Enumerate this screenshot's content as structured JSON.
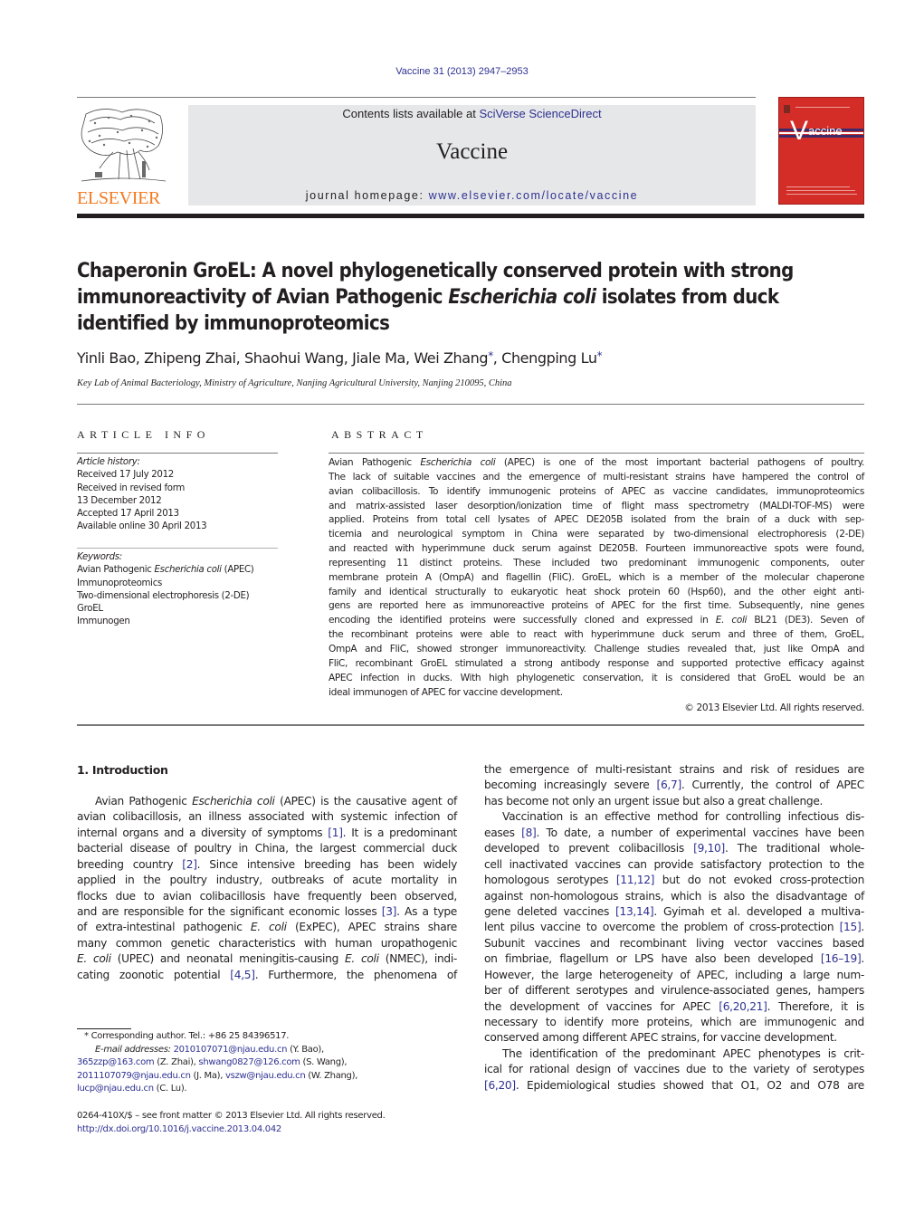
{
  "header": {
    "citation": "Vaccine 31 (2013) 2947–2953",
    "contents_prefix": "Contents lists available at ",
    "contents_link": "SciVerse ScienceDirect",
    "journal_name": "Vaccine",
    "homepage_prefix": "journal homepage: ",
    "homepage_link": "www.elsevier.com/locate/vaccine",
    "publisher_wordmark": "ELSEVIER",
    "cover_title": "accine",
    "cover_initial": "V",
    "colors": {
      "link": "#2e3192",
      "elsevier_orange": "#f47920",
      "cover_red": "#d42d27",
      "masthead_gray": "#e6e7e8"
    }
  },
  "article": {
    "title_lines": [
      "Chaperonin GroEL: A novel phylogenetically conserved protein with strong",
      [
        "immunoreactivity of Avian Pathogenic ",
        "Escherichia coli",
        " isolates from duck"
      ],
      "identified by immunoproteomics"
    ],
    "authors": [
      {
        "name": "Yinli Bao",
        "corresponding": false
      },
      {
        "name": "Zhipeng Zhai",
        "corresponding": false
      },
      {
        "name": "Shaohui Wang",
        "corresponding": false
      },
      {
        "name": "Jiale Ma",
        "corresponding": false
      },
      {
        "name": "Wei Zhang",
        "corresponding": true
      },
      {
        "name": "Chengping Lu",
        "corresponding": true
      }
    ],
    "affiliation": "Key Lab of Animal Bacteriology, Ministry of Agriculture, Nanjing Agricultural University, Nanjing 210095, China"
  },
  "article_info": {
    "heading": "ARTICLE INFO",
    "history_label": "Article history:",
    "history": [
      "Received 17 July 2012",
      "Received in revised form",
      "13 December 2012",
      "Accepted 17 April 2013",
      "Available online 30 April 2013"
    ],
    "keywords_label": "Keywords:",
    "keywords": [
      [
        "Avian Pathogenic ",
        "Escherichia coli",
        " (APEC)"
      ],
      "Immunoproteomics",
      "Two-dimensional electrophoresis (2-DE)",
      "GroEL",
      "Immunogen"
    ]
  },
  "abstract": {
    "heading": "ABSTRACT",
    "lines": [
      [
        "Avian Pathogenic ",
        "Escherichia coli",
        " (APEC) is one of the most important bacterial pathogens of poultry."
      ],
      "The lack of suitable vaccines and the emergence of multi-resistant strains have hampered the control of",
      "avian colibacillosis. To identify immunogenic proteins of APEC as vaccine candidates, immunoproteomics",
      "and matrix-assisted laser desorption/ionization time of flight mass spectrometry (MALDI-TOF-MS) were",
      "applied. Proteins from total cell lysates of APEC DE205B isolated from the brain of a duck with sep-",
      "ticemia and neurological symptom in China were separated by two-dimensional electrophoresis (2-DE)",
      "and reacted with hyperimmune duck serum against DE205B. Fourteen immunoreactive spots were found,",
      "representing 11 distinct proteins. These included two predominant immunogenic components, outer",
      "membrane protein A (OmpA) and flagellin (FliC). GroEL, which is a member of the molecular chaperone",
      "family and identical structurally to eukaryotic heat shock protein 60 (Hsp60), and the other eight anti-",
      "gens are reported here as immunoreactive proteins of APEC for the first time. Subsequently, nine genes",
      [
        "encoding the identified proteins were successfully cloned and expressed in ",
        "E. coli",
        " BL21 (DE3). Seven of"
      ],
      "the recombinant proteins were able to react with hyperimmune duck serum and three of them, GroEL,",
      "OmpA and FliC, showed stronger immunoreactivity. Challenge studies revealed that, just like OmpA and",
      "FliC, recombinant GroEL stimulated a strong antibody response and supported protective efficacy against",
      "APEC infection in ducks. With high phylogenetic conservation, it is considered that GroEL would be an",
      "ideal immunogen of APEC for vaccine development."
    ],
    "copyright": "© 2013 Elsevier Ltd. All rights reserved."
  },
  "body": {
    "section_heading": "1.  Introduction",
    "left_lines": [
      {
        "indent": true,
        "parts": [
          [
            "Avian Pathogenic ",
            ""
          ],
          [
            "Escherichia coli",
            "i"
          ],
          [
            " (APEC) is the causative agent of",
            ""
          ]
        ]
      },
      {
        "parts": [
          [
            "avian colibacillosis, an illness associated with systemic infection of",
            ""
          ]
        ]
      },
      {
        "parts": [
          [
            "internal organs and a diversity of symptoms ",
            ""
          ],
          [
            "[1]",
            "r"
          ],
          [
            ". It is a predominant",
            ""
          ]
        ]
      },
      {
        "parts": [
          [
            "bacterial disease of poultry in China, the largest commercial duck",
            ""
          ]
        ]
      },
      {
        "parts": [
          [
            "breeding country ",
            ""
          ],
          [
            "[2]",
            "r"
          ],
          [
            ". Since intensive breeding has been widely",
            ""
          ]
        ]
      },
      {
        "parts": [
          [
            "applied in the poultry industry, outbreaks of acute mortality in",
            ""
          ]
        ]
      },
      {
        "parts": [
          [
            "flocks due to avian colibacillosis have frequently been observed,",
            ""
          ]
        ]
      },
      {
        "parts": [
          [
            "and are responsible for the significant economic losses ",
            ""
          ],
          [
            "[3]",
            "r"
          ],
          [
            ". As a type",
            ""
          ]
        ]
      },
      {
        "parts": [
          [
            "of extra-intestinal pathogenic ",
            ""
          ],
          [
            "E. coli",
            "i"
          ],
          [
            " (ExPEC), APEC strains share",
            ""
          ]
        ]
      },
      {
        "parts": [
          [
            "many common genetic characteristics with human uropathogenic",
            ""
          ]
        ]
      },
      {
        "parts": [
          [
            "E. coli",
            "i"
          ],
          [
            " (UPEC) and neonatal meningitis-causing ",
            ""
          ],
          [
            "E. coli",
            "i"
          ],
          [
            " (NMEC), indi-",
            ""
          ]
        ]
      },
      {
        "parts": [
          [
            "cating zoonotic potential ",
            ""
          ],
          [
            "[4,5]",
            "r"
          ],
          [
            ". Furthermore, the phenomena of",
            ""
          ]
        ]
      }
    ],
    "right_lines": [
      {
        "parts": [
          [
            "the emergence of multi-resistant strains and risk of residues are",
            ""
          ]
        ]
      },
      {
        "parts": [
          [
            "becoming increasingly severe ",
            ""
          ],
          [
            "[6,7]",
            "r"
          ],
          [
            ". Currently, the control of APEC",
            ""
          ]
        ]
      },
      {
        "last": true,
        "parts": [
          [
            "has become not only an urgent issue but also a great challenge.",
            ""
          ]
        ]
      },
      {
        "indent": true,
        "parts": [
          [
            "Vaccination is an effective method for controlling infectious dis-",
            ""
          ]
        ]
      },
      {
        "parts": [
          [
            "eases ",
            ""
          ],
          [
            "[8]",
            "r"
          ],
          [
            ". To date, a number of experimental vaccines have been",
            ""
          ]
        ]
      },
      {
        "parts": [
          [
            "developed to prevent colibacillosis ",
            ""
          ],
          [
            "[9,10]",
            "r"
          ],
          [
            ". The traditional whole-",
            ""
          ]
        ]
      },
      {
        "parts": [
          [
            "cell inactivated vaccines can provide satisfactory protection to the",
            ""
          ]
        ]
      },
      {
        "parts": [
          [
            "homologous serotypes ",
            ""
          ],
          [
            "[11,12]",
            "r"
          ],
          [
            " but do not evoked cross-protection",
            ""
          ]
        ]
      },
      {
        "parts": [
          [
            "against non-homologous strains, which is also the disadvantage of",
            ""
          ]
        ]
      },
      {
        "parts": [
          [
            "gene deleted vaccines ",
            ""
          ],
          [
            "[13,14]",
            "r"
          ],
          [
            ". Gyimah et al. developed a multiva-",
            ""
          ]
        ]
      },
      {
        "parts": [
          [
            "lent pilus vaccine to overcome the problem of cross-protection ",
            ""
          ],
          [
            "[15]",
            "r"
          ],
          [
            ".",
            ""
          ]
        ]
      },
      {
        "parts": [
          [
            "Subunit vaccines and recombinant living vector vaccines based",
            ""
          ]
        ]
      },
      {
        "parts": [
          [
            "on fimbriae, flagellum or LPS have also been developed ",
            ""
          ],
          [
            "[16–19]",
            "r"
          ],
          [
            ".",
            ""
          ]
        ]
      },
      {
        "parts": [
          [
            "However, the large heterogeneity of APEC, including a large num-",
            ""
          ]
        ]
      },
      {
        "parts": [
          [
            "ber of different serotypes and virulence-associated genes, hampers",
            ""
          ]
        ]
      },
      {
        "parts": [
          [
            "the development of vaccines for APEC ",
            ""
          ],
          [
            "[6,20,21]",
            "r"
          ],
          [
            ". Therefore, it is",
            ""
          ]
        ]
      },
      {
        "parts": [
          [
            "necessary to identify more proteins, which are immunogenic and",
            ""
          ]
        ]
      },
      {
        "last": true,
        "parts": [
          [
            "conserved among different APEC strains, for vaccine development.",
            ""
          ]
        ]
      },
      {
        "indent": true,
        "parts": [
          [
            "The identification of the predominant APEC phenotypes is crit-",
            ""
          ]
        ]
      },
      {
        "parts": [
          [
            "ical for rational design of vaccines due to the variety of serotypes",
            ""
          ]
        ]
      },
      {
        "parts": [
          [
            "[6,20]",
            "r"
          ],
          [
            ". Epidemiological studies showed that O1, O2 and O78 are",
            ""
          ]
        ]
      }
    ]
  },
  "footnotes": {
    "corresponding": "*  Corresponding author. Tel.: +86 25 84396517.",
    "email_label": "E-mail addresses: ",
    "emails": [
      {
        "email": "2010107071@njau.edu.cn",
        "who": " (Y. Bao),"
      },
      {
        "email": "365zzp@163.com",
        "who": " (Z. Zhai), "
      },
      {
        "email": "shwang0827@126.com",
        "who": " (S. Wang),"
      },
      {
        "email": "2011107079@njau.edu.cn",
        "who": " (J. Ma), "
      },
      {
        "email": "vszw@njau.edu.cn",
        "who": " (W. Zhang),"
      },
      {
        "email": "lucp@njau.edu.cn",
        "who": " (C. Lu)."
      }
    ],
    "front_matter": "0264-410X/$ – see front matter © 2013 Elsevier Ltd. All rights reserved.",
    "doi": "http://dx.doi.org/10.1016/j.vaccine.2013.04.042"
  }
}
